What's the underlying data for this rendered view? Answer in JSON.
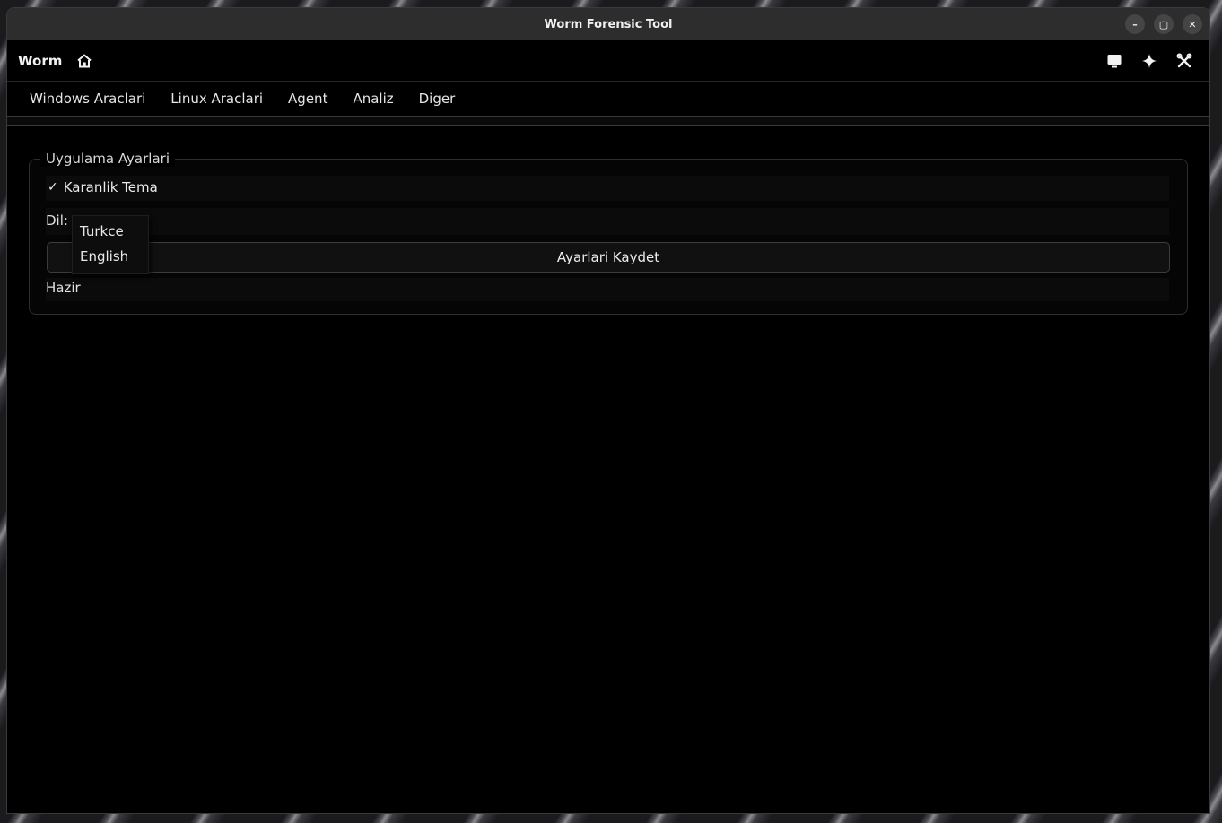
{
  "window": {
    "title": "Worm Forensic Tool",
    "controls": {
      "minimize": "–",
      "maximize": "▢",
      "close": "✕"
    }
  },
  "header": {
    "app_name": "Worm",
    "icons": [
      "home-icon",
      "monitor-icon",
      "sparkle-icon",
      "tools-icon"
    ]
  },
  "menu": {
    "items": [
      "Windows Araclari",
      "Linux Araclari",
      "Agent",
      "Analiz",
      "Diger"
    ]
  },
  "settings": {
    "group_title": "Uygulama Ayarlari",
    "dark_theme": {
      "label": "Karanlik Tema",
      "checked": true,
      "mark": "✓"
    },
    "language": {
      "label": "Dil:",
      "options": [
        "Turkce",
        "English"
      ]
    },
    "save_label": "Ayarlari Kaydet",
    "status": "Hazir"
  },
  "colors": {
    "background": "#000000",
    "titlebar": "#2d2d2d",
    "text": "#eaeaea",
    "border": "#2e2e2e"
  }
}
